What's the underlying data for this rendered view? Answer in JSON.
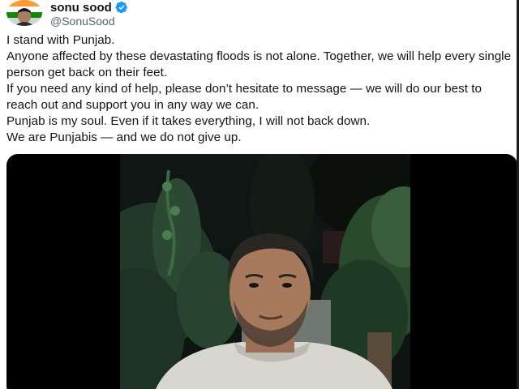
{
  "user": {
    "display_name": "sonu sood",
    "handle": "@SonuSood",
    "avatar_icon": "profile-avatar-icon",
    "verified_icon": "verified-badge-icon",
    "verified_color": "#1d9bf0"
  },
  "tweet": {
    "lines": [
      "I stand with Punjab.",
      "Anyone affected by these devastating floods is not alone. Together, we will help every single person get back on their feet.",
      "If you need any kind of help, please don’t hesitate to message — we will do our best to reach out and support you in any way we can.",
      "Punjab is my soul. Even if it takes everything, I will not back down.",
      "We are Punjabis — and we do not give up."
    ]
  },
  "media": {
    "type": "video",
    "background_color": "#000000"
  }
}
